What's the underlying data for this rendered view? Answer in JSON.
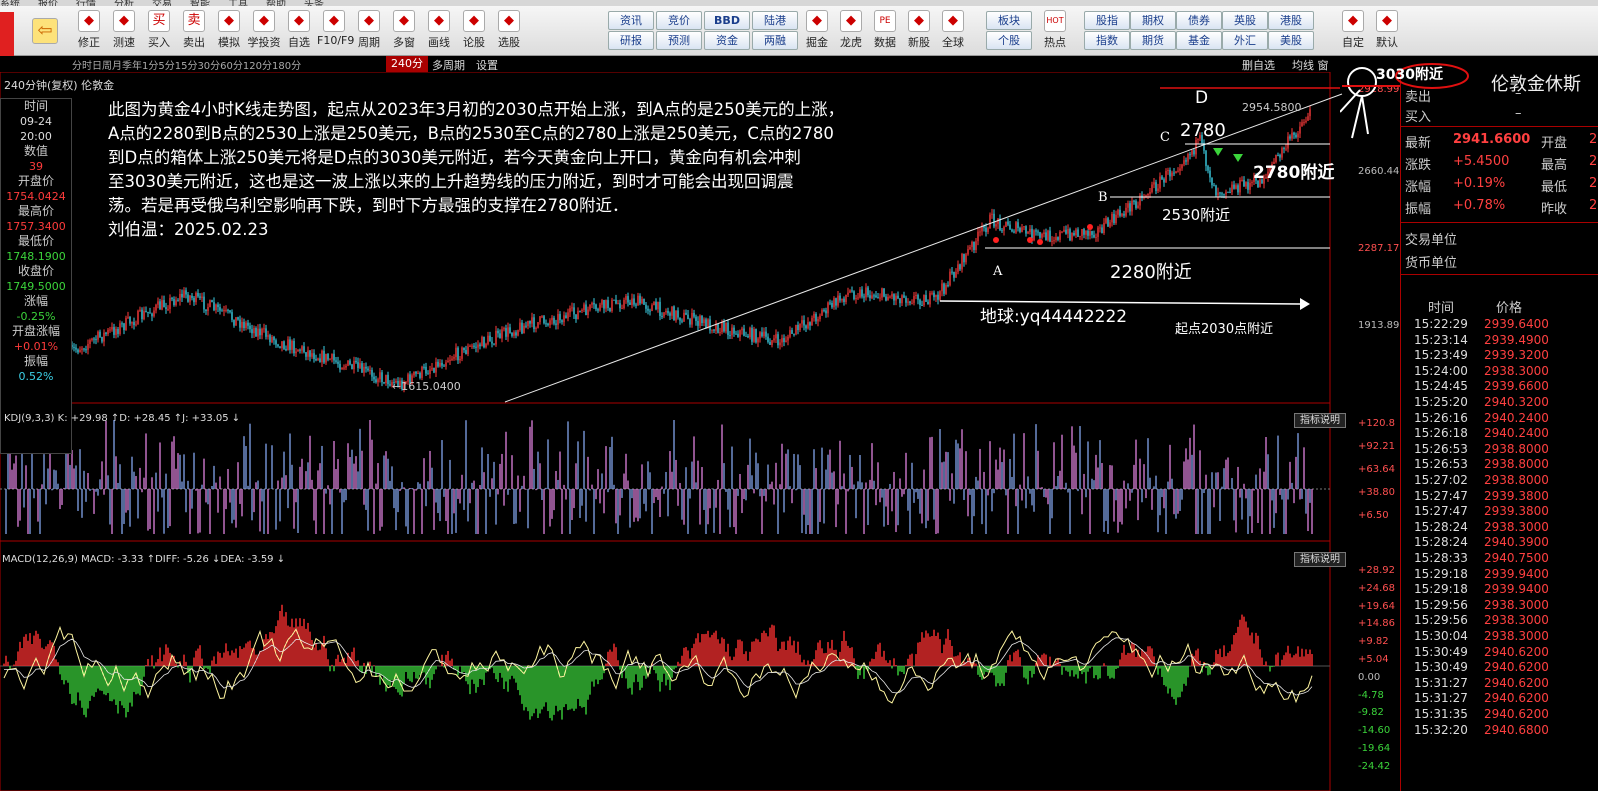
{
  "menubar": [
    "系统",
    "报价",
    "行情",
    "分析",
    "交易",
    "智能",
    "工具",
    "帮助",
    "头条"
  ],
  "toolbar": {
    "buttons": [
      {
        "label": "修正",
        "icon": "arrow-up-icon"
      },
      {
        "label": "测速",
        "icon": "speed-icon"
      },
      {
        "label": "买入",
        "icon": "buy-icon",
        "glyph": "买"
      },
      {
        "label": "卖出",
        "icon": "sell-icon",
        "glyph": "卖"
      },
      {
        "label": "模拟",
        "icon": "hammer-icon"
      },
      {
        "label": "学投资",
        "icon": "mortarboard-icon"
      },
      {
        "label": "自选",
        "icon": "star-icon"
      },
      {
        "label": "F10/F9",
        "icon": "f10-icon"
      },
      {
        "label": "周期",
        "icon": "clock-icon"
      },
      {
        "label": "多窗",
        "icon": "grid-icon"
      },
      {
        "label": "画线",
        "icon": "pencil-icon"
      },
      {
        "label": "论股",
        "icon": "chat-icon"
      },
      {
        "label": "选股",
        "icon": "magnifier-icon"
      }
    ],
    "quick": [
      [
        "资讯",
        "竞价",
        "BBD",
        "陆港"
      ],
      [
        "研报",
        "预测",
        "资金",
        "两融"
      ]
    ],
    "buttons2": [
      {
        "label": "掘金",
        "icon": "dig-icon"
      },
      {
        "label": "龙虎",
        "icon": "dragon-icon"
      },
      {
        "label": "数据",
        "icon": "pe-icon",
        "glyph": "PE"
      },
      {
        "label": "新股",
        "icon": "newstock-icon"
      },
      {
        "label": "全球",
        "icon": "globe-icon"
      }
    ],
    "quick2a": [
      "板块",
      "个股"
    ],
    "hotspot": {
      "label": "热点",
      "icon": "hot-icon",
      "glyph": "HOT"
    },
    "quick2b": [
      [
        "股指",
        "期权",
        "债券",
        "英股",
        "港股"
      ],
      [
        "指数",
        "期货",
        "基金",
        "外汇",
        "美股"
      ]
    ],
    "right_buttons": [
      {
        "label": "自定",
        "icon": "custom-icon"
      },
      {
        "label": "默认",
        "icon": "home-icon"
      }
    ]
  },
  "periodbar": {
    "periods": "分时日周月季年1分5分15分30分60分120分180分",
    "active": "240分",
    "multi": "多周期",
    "settings": "设置",
    "right1": "删自选",
    "right2": "均线 窗"
  },
  "chart": {
    "title": "240分钟(复权) 伦敦金",
    "ann_lines": [
      "此图为黄金4小时K线走势图，起点从2023年3月初的2030点开始上涨，到A点的是250美元的上涨，",
      "A点的2280到B点的2530上涨是250美元，B点的2530至C点的2780上涨是250美元，C点的2780",
      "到D点的箱体上涨250美元将是D点的3030美元附近，若今天黄金向上开口，黄金向有机会冲刺",
      "至3030美元附近，这也是这一波上涨以来的上升趋势线的压力附近，到时才可能会出现回调震",
      "荡。若是再受俄乌利空影响再下跌，到时下方最强的支撑在2780附近．",
      "刘伯温：2025.02.23"
    ],
    "labels": {
      "A": "A",
      "B": "B",
      "C": "C",
      "D": "D",
      "c_val": "2780",
      "near_2780": "2780附近",
      "near_2530": "2530附近",
      "near_2280": "2280附近",
      "near_3030": "3030附近",
      "wechat": "地球:yq44442222",
      "start": "起点2030点附近",
      "low_mark": "←1615.0400",
      "high_mark": "2954.5800"
    },
    "price_axis": [
      "2928.996",
      "2660.448",
      "2287.172",
      "1913.896"
    ],
    "kdj": {
      "text": "KDJ(9,3,3) K: +29.98 ↑D: +28.45 ↑J: +33.05 ↓",
      "axis": [
        "+120.8",
        "+92.21",
        "+63.64",
        "+38.80",
        "+6.50"
      ]
    },
    "macd": {
      "text": "MACD(12,26,9) MACD: -3.33 ↑DIFF: -5.26 ↓DEA: -3.59 ↓",
      "axis": [
        "+28.92",
        "+24.68",
        "+19.64",
        "+14.86",
        "+9.82",
        "+5.04",
        "0.00",
        "-4.78",
        "-9.82",
        "-14.60",
        "-19.64",
        "-24.42"
      ]
    },
    "indicator_button": "指标说明"
  },
  "info_panel": [
    {
      "k": "时间",
      "v": "09-24",
      "cls": "w"
    },
    {
      "k": "",
      "v": "20:00",
      "cls": "w"
    },
    {
      "k": "数值",
      "v": "39",
      "cls": "up"
    },
    {
      "k": "开盘价",
      "v": "1754.0424",
      "cls": "up"
    },
    {
      "k": "最高价",
      "v": "1757.3400",
      "cls": "up"
    },
    {
      "k": "最低价",
      "v": "1748.1900",
      "cls": "dn"
    },
    {
      "k": "收盘价",
      "v": "1749.5000",
      "cls": "dn"
    },
    {
      "k": "涨幅",
      "v": "-0.25%",
      "cls": "dn"
    },
    {
      "k": "开盘涨幅",
      "v": "+0.01%",
      "cls": "up"
    },
    {
      "k": "振幅",
      "v": "0.52%",
      "cls": "cy"
    }
  ],
  "right_panel": {
    "name": "伦敦金休斯",
    "sell_label": "卖出",
    "sell_val": "–",
    "buy_label": "买入",
    "buy_val": "–",
    "rows": [
      {
        "k": "最新",
        "v": "2941.6600",
        "k2": "开盘",
        "v2": "2"
      },
      {
        "k": "涨跌",
        "v": "+5.4500",
        "k2": "最高",
        "v2": "2"
      },
      {
        "k": "涨幅",
        "v": "+0.19%",
        "k2": "最低",
        "v2": "2"
      },
      {
        "k": "振幅",
        "v": "+0.78%",
        "k2": "昨收",
        "v2": "2"
      }
    ],
    "trade_unit": "交易单位",
    "currency_unit": "货币单位",
    "tick_header_time": "时间",
    "tick_header_price": "价格",
    "ticks": [
      [
        "15:22:29",
        "2939.6400"
      ],
      [
        "15:23:14",
        "2939.4900"
      ],
      [
        "15:23:49",
        "2939.3200"
      ],
      [
        "15:24:00",
        "2938.3000"
      ],
      [
        "15:24:45",
        "2939.6600"
      ],
      [
        "15:25:20",
        "2940.3200"
      ],
      [
        "15:26:16",
        "2940.2400"
      ],
      [
        "15:26:18",
        "2940.2400"
      ],
      [
        "15:26:53",
        "2938.8000"
      ],
      [
        "15:26:53",
        "2938.8000"
      ],
      [
        "15:27:02",
        "2938.8000"
      ],
      [
        "15:27:47",
        "2939.3800"
      ],
      [
        "15:27:47",
        "2939.3800"
      ],
      [
        "15:28:24",
        "2938.3000"
      ],
      [
        "15:28:24",
        "2940.3900"
      ],
      [
        "15:28:33",
        "2940.7500"
      ],
      [
        "15:29:18",
        "2939.9400"
      ],
      [
        "15:29:18",
        "2939.9400"
      ],
      [
        "15:29:56",
        "2938.3000"
      ],
      [
        "15:29:56",
        "2938.3000"
      ],
      [
        "15:30:04",
        "2938.3000"
      ],
      [
        "15:30:49",
        "2940.6200"
      ],
      [
        "15:30:49",
        "2940.6200"
      ],
      [
        "15:31:27",
        "2940.6200"
      ],
      [
        "15:31:27",
        "2940.6200"
      ],
      [
        "15:31:35",
        "2940.6200"
      ],
      [
        "15:32:20",
        "2940.6800"
      ]
    ]
  },
  "colors": {
    "up": "#ff3b3b",
    "down": "#3bd43b",
    "bg": "#000000",
    "accent": "#cc0000"
  }
}
